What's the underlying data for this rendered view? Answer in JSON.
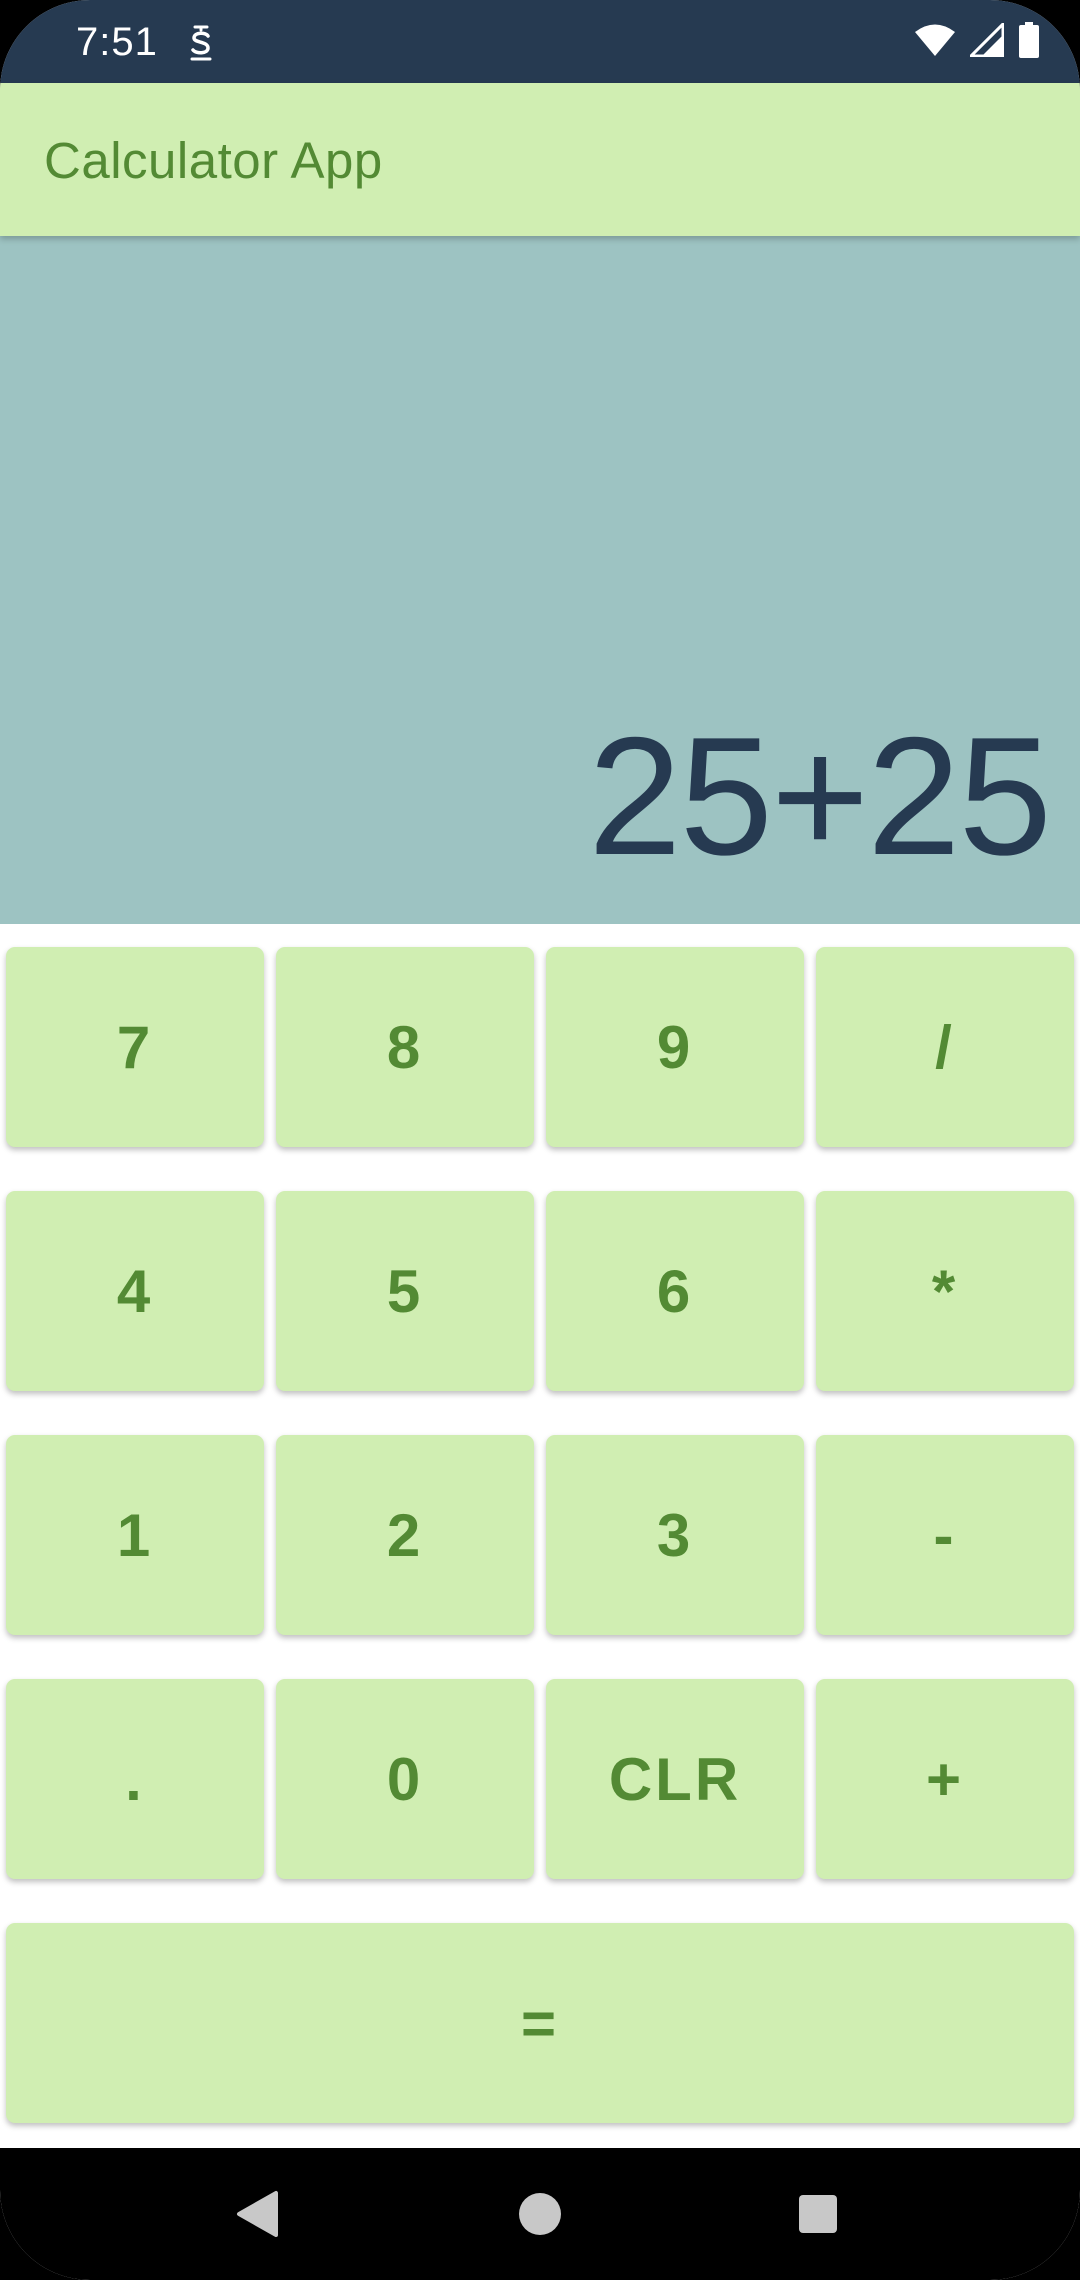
{
  "status_bar": {
    "time": "7:51",
    "app_icon": "s-badge-icon",
    "icons": [
      "wifi-icon",
      "cell-signal-icon",
      "battery-icon"
    ]
  },
  "app_bar": {
    "title": "Calculator App"
  },
  "display": {
    "expression": "25+25"
  },
  "keypad": {
    "rows": [
      [
        "7",
        "8",
        "9",
        "/"
      ],
      [
        "4",
        "5",
        "6",
        "*"
      ],
      [
        "1",
        "2",
        "3",
        "-"
      ],
      [
        ".",
        "0",
        "CLR",
        "+"
      ]
    ],
    "equals": "="
  },
  "nav_bar": {
    "icons": [
      "back-icon",
      "home-icon",
      "recents-icon"
    ]
  },
  "colors": {
    "status_bar": "#263a51",
    "accent_green": "#538a34",
    "button_bg": "#d0eeb2",
    "display_bg": "#9dc3c2",
    "display_text": "#263a51"
  }
}
